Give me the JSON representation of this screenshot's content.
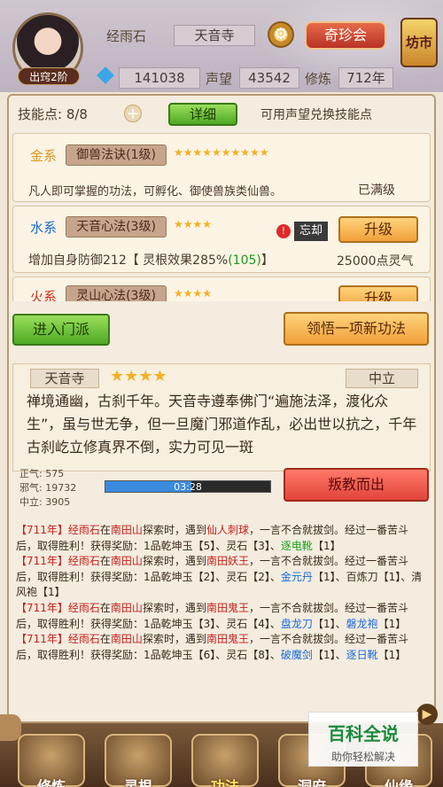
{
  "header": {
    "rank_label": "出窍2阶",
    "name": "经雨石",
    "sect": "天音寺",
    "treasure_button": "奇珍会",
    "market_button": "坊市",
    "spirit_stones": "141038",
    "reputation_label": "声望",
    "reputation_value": "43542",
    "cultivation_label": "修炼",
    "cultivation_value": "712年"
  },
  "skills": {
    "points_label": "技能点: 8/8",
    "detail_button": "详细",
    "hint": "可用声望兑换技能点",
    "items": [
      {
        "element": "金系",
        "element_color": "#e0961e",
        "name": "御兽法诀(1级)",
        "stars": 10,
        "desc": "凡人即可掌握的功法，可孵化、御使兽族类仙兽。",
        "status": "已满级"
      },
      {
        "element": "水系",
        "element_color": "#1a6ad8",
        "name": "天音心法(3级)",
        "stars": 4,
        "cooldown": "忘却",
        "upgrade_button": "升级",
        "effect": "增加自身防御212【 灵根效果285%",
        "effect_bonus": "(105)",
        "effect_end": "】",
        "cost": "25000点灵气"
      },
      {
        "element": "火系",
        "element_color": "#d82a1a",
        "name": "灵山心法(3级)",
        "stars": 4,
        "upgrade_button": "升级"
      }
    ]
  },
  "actions": {
    "join_sect": "进入门派",
    "learn_new": "领悟一项新功法"
  },
  "sect_info": {
    "name": "天音寺",
    "stars": 4,
    "alignment": "中立",
    "lore": "禅境通幽，古刹千年。天音寺遵奉佛门“遍施法泽，渡化众生”，虽与世无争，但一旦魔门邪道作乱，必出世以抗之，千年古刹屹立修真界不倒，实力可见一斑",
    "righteous": "正气: 575",
    "evil": "邪气: 19732",
    "neutral": "中立: 3905",
    "timer": "03:28",
    "timer_progress": 0.52,
    "betray_button": "叛教而出"
  },
  "log": [
    [
      [
        "r",
        "【711年】经雨石"
      ],
      [
        "n",
        "在"
      ],
      [
        "r",
        "南田山"
      ],
      [
        "n",
        "探索时，遇到"
      ],
      [
        "r",
        "仙人刺球"
      ],
      [
        "n",
        "，一言不合就拔剑。经过一番苦斗后，取得胜利！获得奖励：1品乾坤玉【5】、灵石【3】、"
      ],
      [
        "g",
        "逐电靴"
      ],
      [
        "n",
        "【1】"
      ]
    ],
    [
      [
        "r",
        "【711年】经雨石"
      ],
      [
        "n",
        "在"
      ],
      [
        "r",
        "南田山"
      ],
      [
        "n",
        "探索时，遇到"
      ],
      [
        "r",
        "南田妖王"
      ],
      [
        "n",
        "，一言不合就拔剑。经过一番苦斗后，取得胜利！获得奖励：1品乾坤玉【2】、灵石【2】、"
      ],
      [
        "b",
        "金元丹"
      ],
      [
        "n",
        "【1】、百炼刀【1】、清风袍【1】"
      ]
    ],
    [
      [
        "r",
        "【711年】经雨石"
      ],
      [
        "n",
        "在"
      ],
      [
        "r",
        "南田山"
      ],
      [
        "n",
        "探索时，遇到"
      ],
      [
        "r",
        "南田鬼王"
      ],
      [
        "n",
        "，一言不合就拔剑。经过一番苦斗后，取得胜利！获得奖励：1品乾坤玉【3】、灵石【4】、"
      ],
      [
        "b",
        "盘龙刀"
      ],
      [
        "n",
        "【1】、"
      ],
      [
        "b",
        "磐龙袍"
      ],
      [
        "n",
        "【1】"
      ]
    ],
    [
      [
        "r",
        "【711年】经雨石"
      ],
      [
        "n",
        "在"
      ],
      [
        "r",
        "南田山"
      ],
      [
        "n",
        "探索时，遇到"
      ],
      [
        "r",
        "南田鬼王"
      ],
      [
        "n",
        "，一言不合就拔剑。经过一番苦斗后，取得胜利！获得奖励：1品乾坤玉【6】、灵石【8】、"
      ],
      [
        "b",
        "破魔剑"
      ],
      [
        "n",
        "【1】、"
      ],
      [
        "b",
        "逐日靴"
      ],
      [
        "n",
        "【1】"
      ]
    ]
  ],
  "nav": [
    "修炼",
    "灵根",
    "功法",
    "洞府",
    "仙缘"
  ],
  "watermark": {
    "title": "百科全说",
    "subtitle": "助你轻松解决"
  }
}
